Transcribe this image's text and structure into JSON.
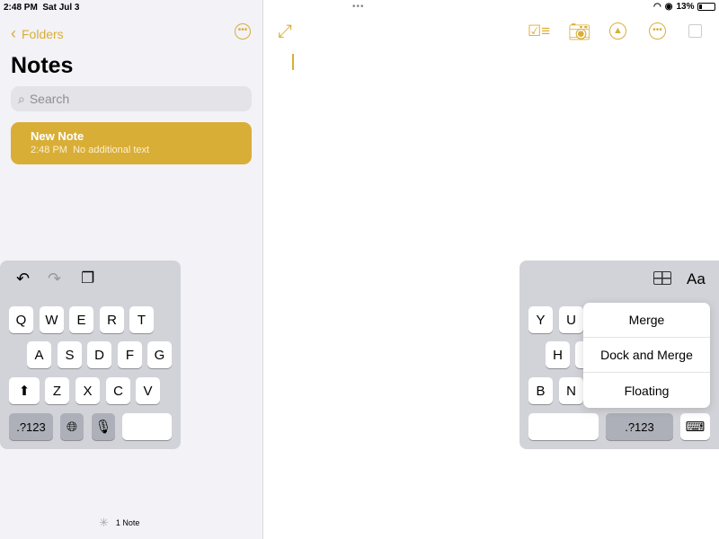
{
  "status": {
    "time": "2:48 PM",
    "date": "Sat Jul 3",
    "battery": "13%",
    "battery_level": 13
  },
  "sidebar": {
    "back_label": "Folders",
    "title": "Notes",
    "search_placeholder": "Search",
    "notes": [
      {
        "title": "New Note",
        "time": "2:48 PM",
        "preview": "No additional text"
      }
    ],
    "footer": "1 Note"
  },
  "colors": {
    "accent": "#d9ae37",
    "selected_note": "#d9ae37"
  },
  "left_keyboard": {
    "rows": [
      [
        "Q",
        "W",
        "E",
        "R",
        "T"
      ],
      [
        "A",
        "S",
        "D",
        "F",
        "G"
      ],
      [
        "Z",
        "X",
        "C",
        "V"
      ]
    ],
    "numbers_label": ".?123"
  },
  "right_keyboard": {
    "rows": [
      [
        "Y",
        "U"
      ],
      [
        "H"
      ],
      [
        "B",
        "N"
      ]
    ],
    "numbers_label": ".?123",
    "format_label": "Aa"
  },
  "keyboard_menu": [
    "Merge",
    "Dock and Merge",
    "Floating"
  ]
}
